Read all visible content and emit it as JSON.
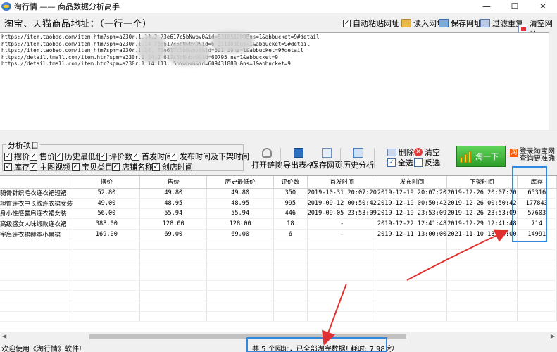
{
  "window": {
    "title": "淘行情 —— 商品数据分析高手",
    "min_label": "—",
    "max_label": "☐",
    "close_label": "✕"
  },
  "header": {
    "url_label": "淘宝、天猫商品地址：（一行一个）",
    "auto_paste": {
      "label": "自动粘贴网址",
      "checked": true
    },
    "read_url": "读入网址",
    "save_url": "保存网址",
    "filter_dup": "过滤重复",
    "clear_url": "清空网址"
  },
  "urls": [
    "https://item.taobao.com/item.htm?spm=a230r.1.14.2 73e617c5bNwbv0&id=5318512098ns=1&abbucket=9#detail",
    "https://item.taobao.com/item.htm?spm=a230r.1.14 73e617c5bNwbv0&id=6 3111088ns=1&abbucket=9#detail",
    "https://item.taobao.com/item.htm?spm=a230r.1.14. 73e617c5bNwbv0&id=601 39ns=1&abbucket=9#detail",
    "https://detail.tmall.com/item.htm?spm=a230r.1.14.2 617c5bNwbv0&id=60795 ns=1&abbucket=9",
    "https://detail.tmall.com/item.htm?spm=a230r.1.14.113. 5bNwbv0&id=609431880 &ns=1&abbucket=9"
  ],
  "analysis": {
    "title": "分析项目",
    "row1": [
      {
        "label": "摆价",
        "checked": true
      },
      {
        "label": "售价",
        "checked": true
      },
      {
        "label": "历史最低价",
        "checked": true
      },
      {
        "label": "评价数",
        "checked": true
      },
      {
        "label": "首发时间",
        "checked": true
      },
      {
        "label": "发布时间及下架时间",
        "checked": true
      }
    ],
    "row2": [
      {
        "label": "库存",
        "checked": true
      },
      {
        "label": "主图视频",
        "checked": true
      },
      {
        "label": "宝贝类目",
        "checked": true
      },
      {
        "label": "店铺名称",
        "checked": true
      },
      {
        "label": "创店时间",
        "checked": true
      }
    ]
  },
  "toolbar": {
    "open_link": "打开链接",
    "export_table": "导出表格",
    "save_page": "保存网页",
    "history": "历史分析",
    "delete": "删除",
    "clear": "清空",
    "select_all": "全选",
    "invert": "反选",
    "go": "淘一下",
    "login_line1": "登录淘宝网",
    "login_line2": "查询更准确"
  },
  "grid": {
    "columns": [
      "",
      "摆价",
      "售价",
      "历史最低价",
      "评价数",
      "首发时间",
      "发布时间",
      "下架时间",
      "库存"
    ],
    "rows": [
      [
        "骑骨针织毛衣连衣裙短裙",
        "52.80",
        "49.80",
        "49.80",
        "350",
        "2019-10-31 20:07:20",
        "2019-12-19 20:07:20",
        "2019-12-26 20:07:20",
        "65316"
      ],
      [
        "坦臀连衣中长款连衣裙女装",
        "49.00",
        "48.95",
        "48.95",
        "995",
        "2019-09-12 00:50:42",
        "2019-12-19 00:50:42",
        "2019-12-26 00:50:42",
        "177843"
      ],
      [
        "身小性感露肩连衣裙女装",
        "56.00",
        "55.94",
        "55.94",
        "446",
        "2019-09-05 23:53:09",
        "2019-12-19 23:53:09",
        "2019-12-26 23:53:09",
        "57603"
      ],
      [
        "高级感女人味缎款连衣裙",
        "388.00",
        "128.00",
        "128.00",
        "18",
        "-",
        "2019-12-22 12:41:48",
        "2019-12-29 12:41:48",
        "714"
      ],
      [
        "字肩连衣裙赫本小黑裙",
        "169.00",
        "69.00",
        "69.00",
        "6",
        "-",
        "2019-12-11 13:00:00",
        "2021-11-10 13:00:00",
        "14991"
      ]
    ]
  },
  "status": {
    "welcome": "欢迎使用《淘行情》软件!",
    "summary": "共 5 个网址，已全部淘完数据! 耗时: 7.98 秒"
  },
  "colors": {
    "go_button": "#2e9e2a",
    "highlight_box": "#3388dd",
    "annotation_arrow": "#e03030"
  }
}
